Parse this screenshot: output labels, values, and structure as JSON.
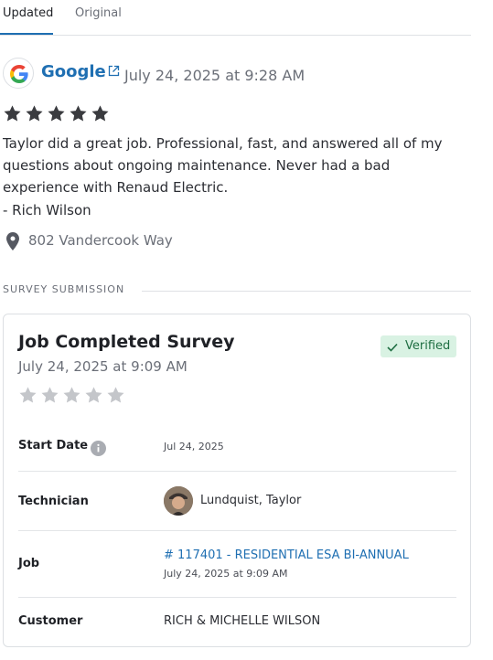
{
  "tabs": [
    {
      "label": "Updated",
      "active": true
    },
    {
      "label": "Original",
      "active": false
    }
  ],
  "review": {
    "source": "Google",
    "source_icon": "google-logo",
    "external_icon": "external-link-icon",
    "date": "July 24, 2025 at 9:28 AM",
    "rating": 5,
    "max_rating": 5,
    "text": "Taylor did a great job. Professional, fast, and answered all of my questions about ongoing maintenance. Never had a bad experience with Renaud Electric.",
    "author": "- Rich Wilson",
    "location": "802 Vandercook Way"
  },
  "survey_section": {
    "title": "SURVEY SUBMISSION"
  },
  "survey": {
    "title": "Job Completed Survey",
    "date": "July 24, 2025 at 9:09 AM",
    "verified_label": "Verified",
    "rating": 0,
    "max_rating": 5,
    "fields": {
      "start_date": {
        "label": "Start Date",
        "value": "Jul 24, 2025"
      },
      "technician": {
        "label": "Technician",
        "value": "Lundquist, Taylor"
      },
      "job": {
        "label": "Job",
        "value": "# 117401 - RESIDENTIAL ESA BI-ANNUAL",
        "sub": "July 24, 2025 at 9:09 AM"
      },
      "customer": {
        "label": "Customer",
        "value": "RICH & MICHELLE WILSON"
      }
    }
  },
  "colors": {
    "accent": "#1f6fb2",
    "star_filled": "#3a3b3f",
    "star_empty": "#c4c6ca",
    "verified_bg": "#d9f2e3",
    "verified_text": "#1e6e42"
  }
}
